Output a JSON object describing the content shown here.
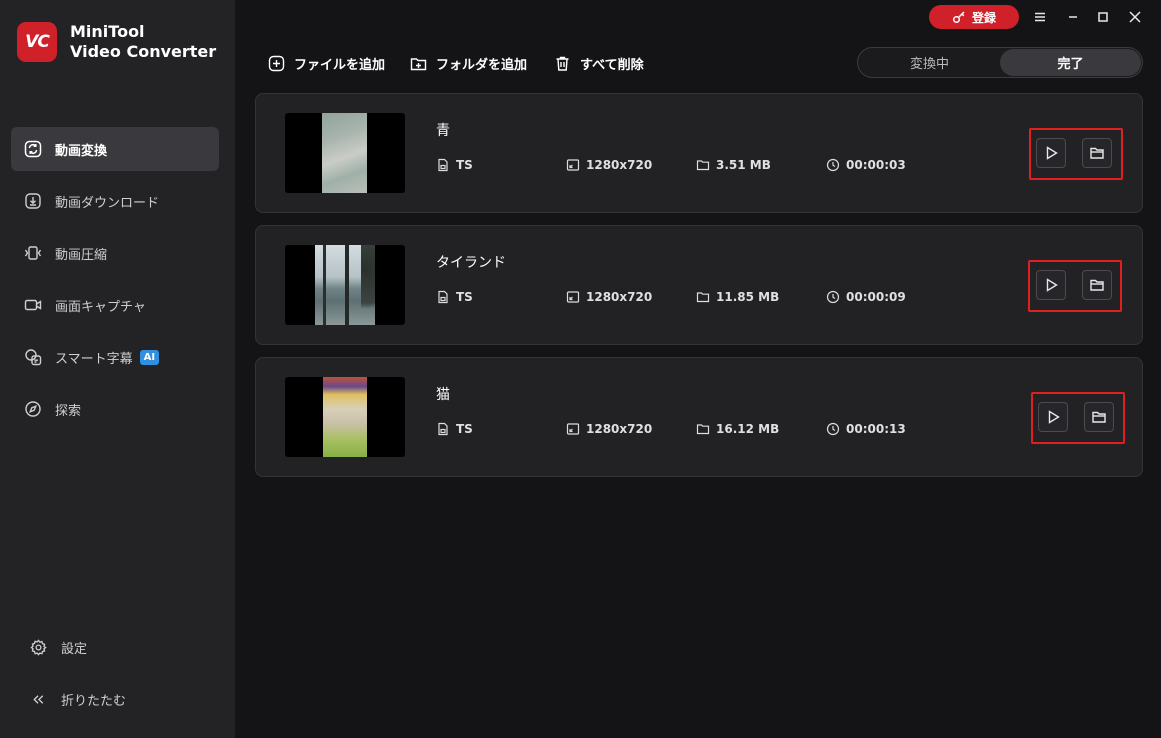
{
  "app": {
    "title_line1": "MiniTool",
    "title_line2": "Video Converter",
    "logo_text": "VC"
  },
  "sidebar": {
    "items": [
      {
        "label": "動画変換",
        "icon": "convert-icon"
      },
      {
        "label": "動画ダウンロード",
        "icon": "download-icon"
      },
      {
        "label": "動画圧縮",
        "icon": "compress-icon"
      },
      {
        "label": "画面キャプチャ",
        "icon": "camera-icon"
      },
      {
        "label": "スマート字幕",
        "icon": "subtitle-icon",
        "badge": "AI"
      },
      {
        "label": "探索",
        "icon": "compass-icon"
      }
    ],
    "settings_label": "設定",
    "collapse_label": "折りたたむ"
  },
  "titlebar": {
    "register_label": "登録"
  },
  "toolbar": {
    "add_file": "ファイルを追加",
    "add_folder": "フォルダを追加",
    "delete_all": "すべて削除"
  },
  "tabs": {
    "converting": "変換中",
    "done": "完了"
  },
  "files": [
    {
      "name": "青",
      "format": "TS",
      "resolution": "1280x720",
      "size": "3.51 MB",
      "duration": "00:00:03"
    },
    {
      "name": "タイランド",
      "format": "TS",
      "resolution": "1280x720",
      "size": "11.85 MB",
      "duration": "00:00:09"
    },
    {
      "name": "猫",
      "format": "TS",
      "resolution": "1280x720",
      "size": "16.12 MB",
      "duration": "00:00:13"
    }
  ],
  "colors": {
    "accent": "#d0202a",
    "highlight": "#e02020",
    "sidebar_bg": "#232326",
    "main_bg": "#141416"
  }
}
